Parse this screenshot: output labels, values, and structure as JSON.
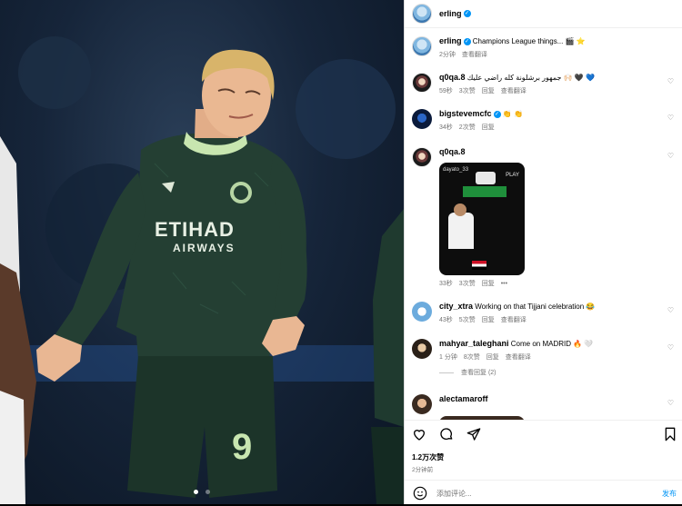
{
  "post": {
    "author": "erling",
    "caption": "Champions League things... 🎬 ⭐",
    "caption_time": "2分钟",
    "caption_translate": "查看翻译",
    "likes": "1.2万次赞",
    "posted": "2分钟前"
  },
  "photo": {
    "sponsor_text": "ETIHAD",
    "sponsor_sub": "AIRWAYS",
    "number": "9",
    "carousel_pages": 2,
    "carousel_active": 1
  },
  "comments": [
    {
      "user": "q0qa.8",
      "text": "جمهور برشلونة كله راضي عليك 🙌🏻 🖤 💙",
      "time": "59秒",
      "likes": "3次赞",
      "reply": "回复",
      "translate": "查看翻译"
    },
    {
      "user": "bigstevemcfc",
      "text": "👏 👏",
      "time": "34秒",
      "likes": "2次赞",
      "reply": "回复"
    },
    {
      "user": "q0qa.8",
      "text": "",
      "time": "33秒",
      "likes": "3次赞",
      "reply": "回复",
      "more": "•••"
    },
    {
      "user": "city_xtra",
      "text": "Working on that Tijjani celebration 😂",
      "time": "43秒",
      "likes": "5次赞",
      "reply": "回复",
      "translate": "查看翻译"
    },
    {
      "user": "mahyar_taleghani",
      "text": "Come on MADRID 🔥 🤍",
      "time": "1 分钟",
      "likes": "8次赞",
      "reply": "回复",
      "translate": "查看翻译",
      "view_replies": "查看回复 (2)"
    },
    {
      "user": "alectamaroff"
    }
  ],
  "sticker": {
    "top_text": "dayato_33",
    "play": "PLAY"
  },
  "add_comment_placeholder": "添加评论...",
  "post_button": "发布",
  "colors": {
    "link": "#0095f6",
    "kit": "#243f33",
    "secondary": "#737373"
  },
  "icons": [
    "heart-icon",
    "comment-icon",
    "share-icon",
    "bookmark-icon",
    "emoji-icon",
    "verified-icon"
  ]
}
